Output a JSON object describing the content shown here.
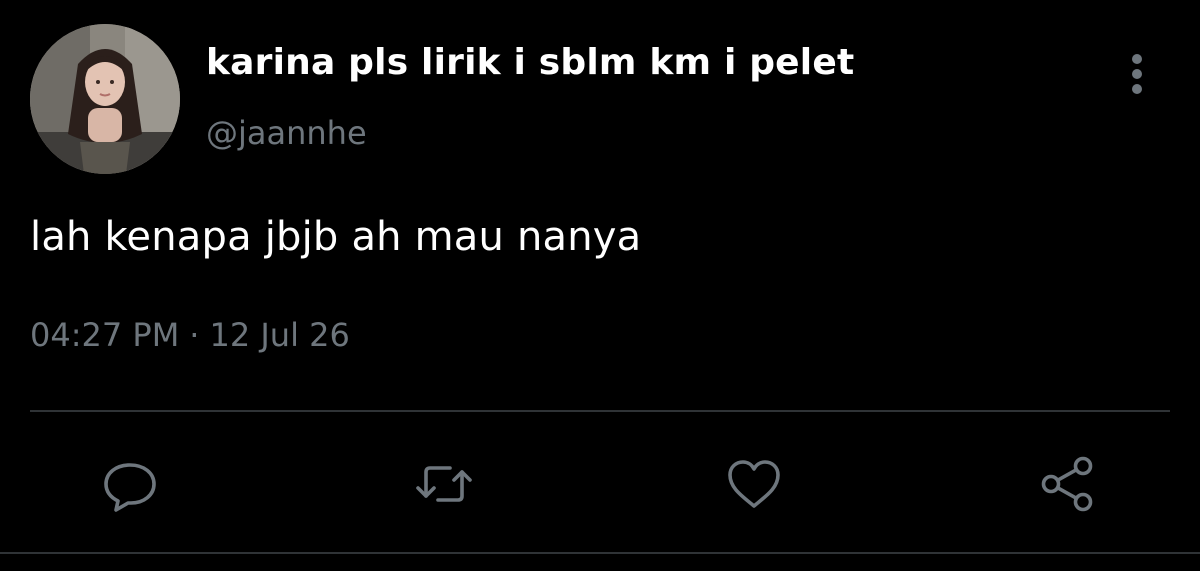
{
  "tweet": {
    "display_name": "karina pls lirik i sblm km i pelet",
    "handle": "@jaannhe",
    "text": "lah kenapa jbjb ah mau nanya",
    "time": "04:27 PM",
    "separator": "·",
    "date": "12 Jul 26"
  },
  "icons": {
    "more": "more-vertical-icon",
    "reply": "reply-icon",
    "retweet": "retweet-icon",
    "like": "heart-icon",
    "share": "share-icon"
  },
  "colors": {
    "background": "#000000",
    "primary_text": "#ffffff",
    "secondary_text": "#6e767d",
    "divider": "#2f3336"
  }
}
